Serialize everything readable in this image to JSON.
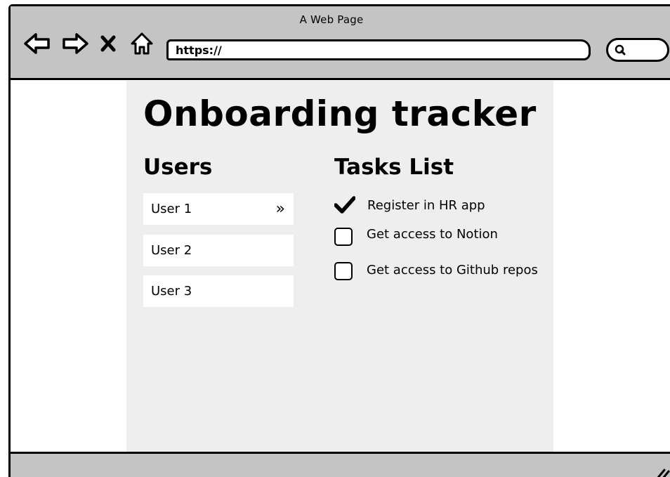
{
  "window": {
    "title": "A Web Page"
  },
  "browser": {
    "url": "https://",
    "search_icon": "search-icon",
    "nav_icons": [
      "back-arrow-icon",
      "forward-arrow-icon",
      "close-icon",
      "home-icon"
    ]
  },
  "page": {
    "title": "Onboarding tracker",
    "users": {
      "heading": "Users",
      "items": [
        {
          "label": "User 1",
          "selected": true
        },
        {
          "label": "User 2",
          "selected": false
        },
        {
          "label": "User 3",
          "selected": false
        }
      ],
      "selected_indicator": "»"
    },
    "tasks": {
      "heading": "Tasks List",
      "items": [
        {
          "label": "Register in HR app",
          "done": true
        },
        {
          "label": "Get access to Notion",
          "done": false
        },
        {
          "label": "Get access to Github repos",
          "done": false
        }
      ]
    }
  },
  "colors": {
    "chrome": "#c4c4c4",
    "content_background": "#eeeeee",
    "ink": "#000000"
  }
}
